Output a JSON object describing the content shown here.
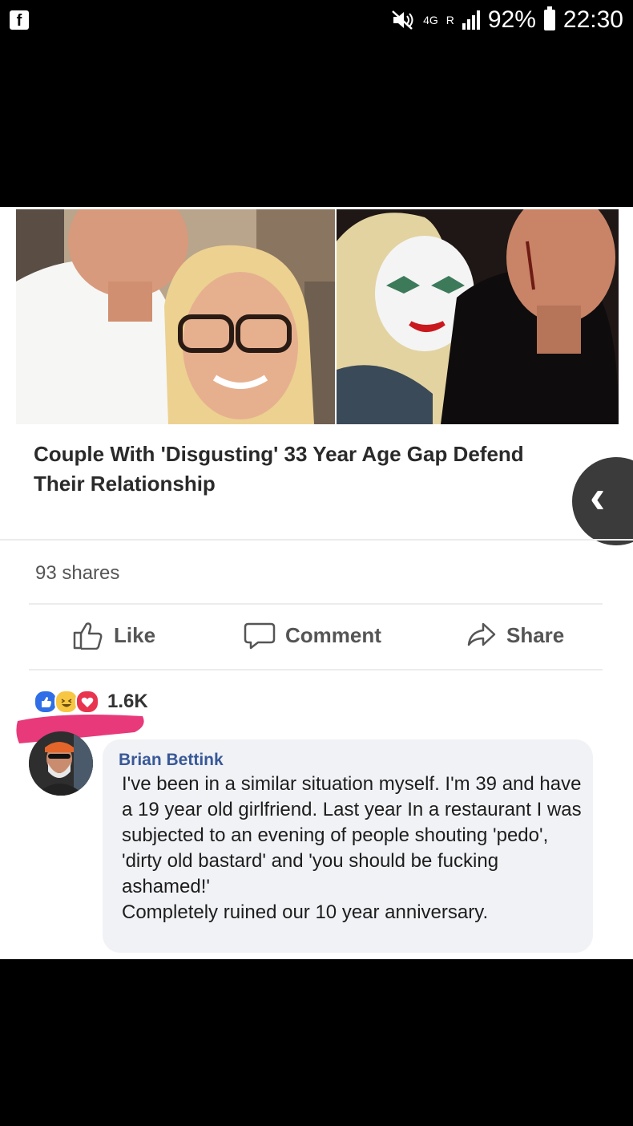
{
  "status_bar": {
    "app_icon": "facebook-f-icon",
    "network": "4G",
    "roaming": "R",
    "battery": "92%",
    "time": "22:30"
  },
  "post": {
    "headline": "Couple With 'Disgusting' 33 Year Age Gap Defend Their Relationship",
    "shares": "93 shares",
    "actions": {
      "like": "Like",
      "comment": "Comment",
      "share": "Share"
    },
    "reaction_count": "1.6K",
    "reaction_icons": [
      "like-reaction-icon",
      "haha-reaction-icon",
      "love-reaction-icon"
    ]
  },
  "comment": {
    "author": "Brian Bettink",
    "text": "I've been in a similar situation  myself. I'm 39 and have a 19 year old girlfriend. Last year In a restaurant I was subjected to an evening of people shouting 'pedo', 'dirty old bastard' and 'you should be fucking ashamed!'\nCompletely ruined our 10 year anniversary."
  },
  "colors": {
    "link_blue": "#385898",
    "redaction_pink": "#e8397a",
    "like_blue": "#2f6ee6",
    "love_red": "#e8344e",
    "haha_yellow": "#f7c743"
  }
}
